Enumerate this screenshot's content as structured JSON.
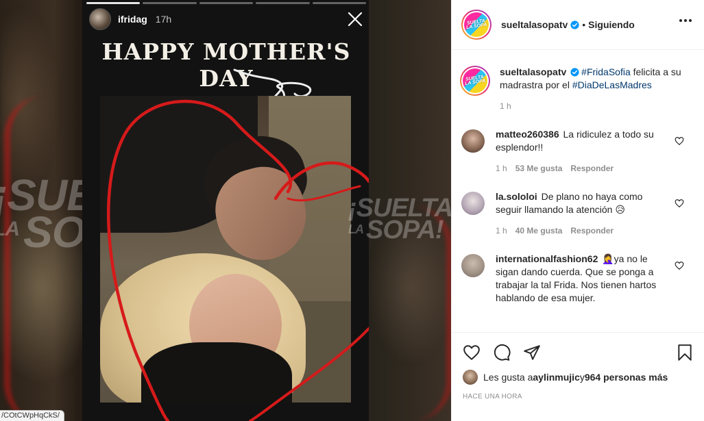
{
  "story": {
    "username": "ifridag",
    "time": "17h",
    "title": "HAPPY MOTHER'S DAY"
  },
  "watermark": {
    "line1": "¡SUELTA",
    "line2a": "LA",
    "line2b": "SOPA!"
  },
  "url_tag": "/COtCWpHqCkS/",
  "post": {
    "account": "sueltalasopatv",
    "separator": "•",
    "follow_status": "Siguiendo",
    "logo_text": "SUELTA LA SOPA",
    "caption": {
      "user": "sueltalasopatv",
      "hashtag1": "#FridaSofia",
      "text1": " felicita a su madrastra por el ",
      "hashtag2": "#DiaDeLasMadres",
      "time": "1 h"
    },
    "comments": [
      {
        "user": "matteo260386",
        "text": "La ridiculez a todo su esplendor!!",
        "time": "1 h",
        "likes": "53 Me gusta",
        "reply": "Responder"
      },
      {
        "user": "la.sololoi",
        "text": "De plano no haya como seguir llamando la atención 😥",
        "time": "1 h",
        "likes": "40 Me gusta",
        "reply": "Responder"
      },
      {
        "user": "internationalfashion62",
        "text": "🤦‍♀️ya no le sigan dando cuerda. Que se ponga a trabajar la tal Frida. Nos tienen hartos hablando de esa mujer."
      }
    ],
    "likes": {
      "prefix": "Les gusta a ",
      "user": "aylinmujic",
      "middle": " y ",
      "count": "964 personas más"
    },
    "time_ago": "HACE UNA HORA"
  },
  "colors": {
    "verified": "#0095f6",
    "hashtag": "#00376b",
    "meta": "#8e8e8e",
    "heart": "#d61a1a"
  },
  "icons": [
    "close-icon",
    "verified-icon",
    "more-icon",
    "heart-icon",
    "comment-icon",
    "share-icon",
    "save-icon"
  ]
}
